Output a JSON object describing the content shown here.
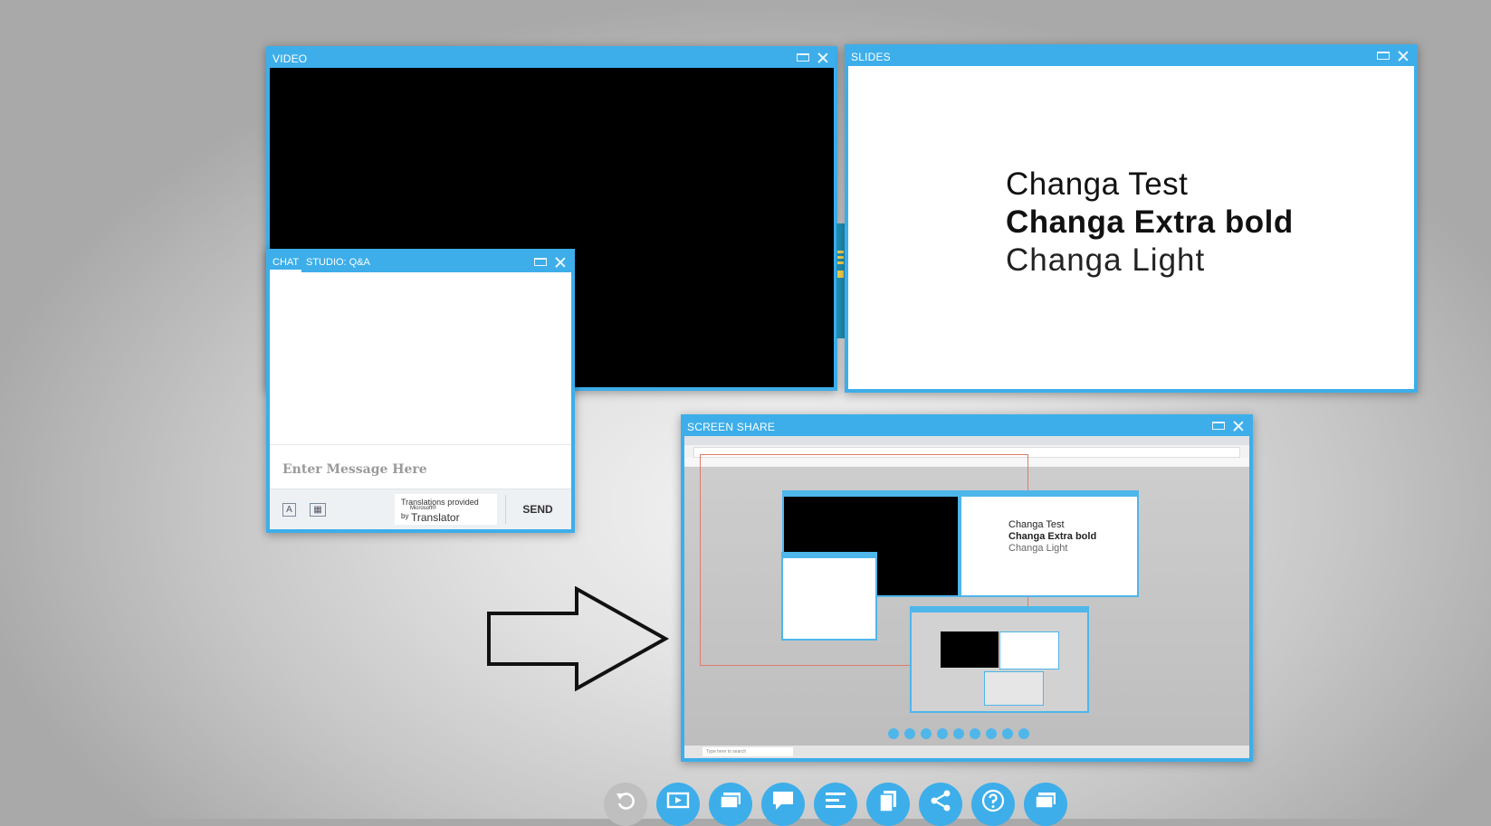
{
  "windows": {
    "video": {
      "title": "VIDEO"
    },
    "slides": {
      "title": "SLIDES",
      "lines": [
        "Changa Test",
        "Changa Extra bold",
        "Changa Light"
      ]
    },
    "chat": {
      "tabs": [
        "CHAT",
        "STUDIO: Q&A"
      ],
      "input_placeholder": "Enter Message Here",
      "translator": {
        "line1": "Translations provided",
        "by": "by",
        "microsoft": "Microsoft®",
        "name": "Translator"
      },
      "send_label": "SEND"
    },
    "screen_share": {
      "title": "SCREEN SHARE",
      "taskbar_search": "Type here to search",
      "inner_slide_lines": [
        "Changa Test",
        "Changa Extra bold",
        "Changa Light"
      ]
    }
  },
  "colors": {
    "accent": "#3daee9",
    "dock_disabled": "#bfbfbf"
  },
  "dock": {
    "buttons": [
      {
        "icon": "reset-icon",
        "state": "disabled"
      },
      {
        "icon": "video-icon"
      },
      {
        "icon": "slides-icon"
      },
      {
        "icon": "chat-icon"
      },
      {
        "icon": "qa-list-icon"
      },
      {
        "icon": "document-icon"
      },
      {
        "icon": "share-icon"
      },
      {
        "icon": "help-icon"
      },
      {
        "icon": "screen-share-icon"
      }
    ]
  }
}
